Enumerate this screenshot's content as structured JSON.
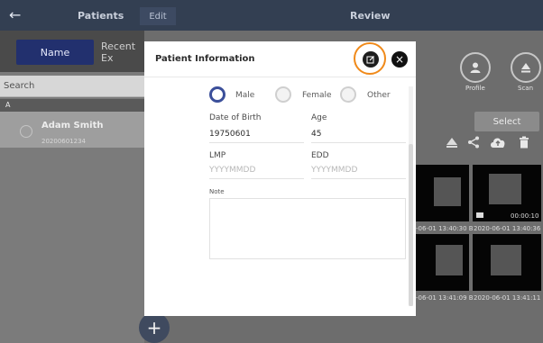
{
  "topbar": {
    "back_icon": "back-arrow-icon",
    "patients_title": "Patients",
    "edit_label": "Edit",
    "review_title": "Review"
  },
  "sidebar": {
    "tabs": [
      {
        "label": "Name",
        "active": true
      },
      {
        "label": "Recent Ex"
      }
    ],
    "search_placeholder": "Search",
    "group_letter": "A",
    "patient": {
      "name": "Adam Smith",
      "id": "20200601234"
    }
  },
  "review": {
    "profile_label": "Profile",
    "scan_label": "Scan",
    "select_label": "Select",
    "thumbnails": [
      {
        "timestamp": "-06-01 13:40:30 B",
        "duration": ""
      },
      {
        "timestamp": "2020-06-01 13:40:36 B",
        "duration": "00:00:10"
      },
      {
        "timestamp": "-06-01 13:41:09 B",
        "duration": ""
      },
      {
        "timestamp": "2020-06-01 13:41:11 B",
        "duration": ""
      }
    ]
  },
  "fab": {
    "label": "+"
  },
  "modal": {
    "title": "Patient Information",
    "gender": {
      "options": [
        "Male",
        "Female",
        "Other"
      ],
      "selected": "Male"
    },
    "dob": {
      "label": "Date of Birth",
      "value": "19750601"
    },
    "age": {
      "label": "Age",
      "value": "45"
    },
    "lmp": {
      "label": "LMP",
      "placeholder": "YYYYMMDD"
    },
    "edd": {
      "label": "EDD",
      "placeholder": "YYYYMMDD"
    },
    "note": {
      "label": "Note",
      "value": ""
    }
  },
  "colors": {
    "accent": "#f08a1a",
    "nav": "#333f52",
    "selected_radio": "#3b4f9a"
  }
}
